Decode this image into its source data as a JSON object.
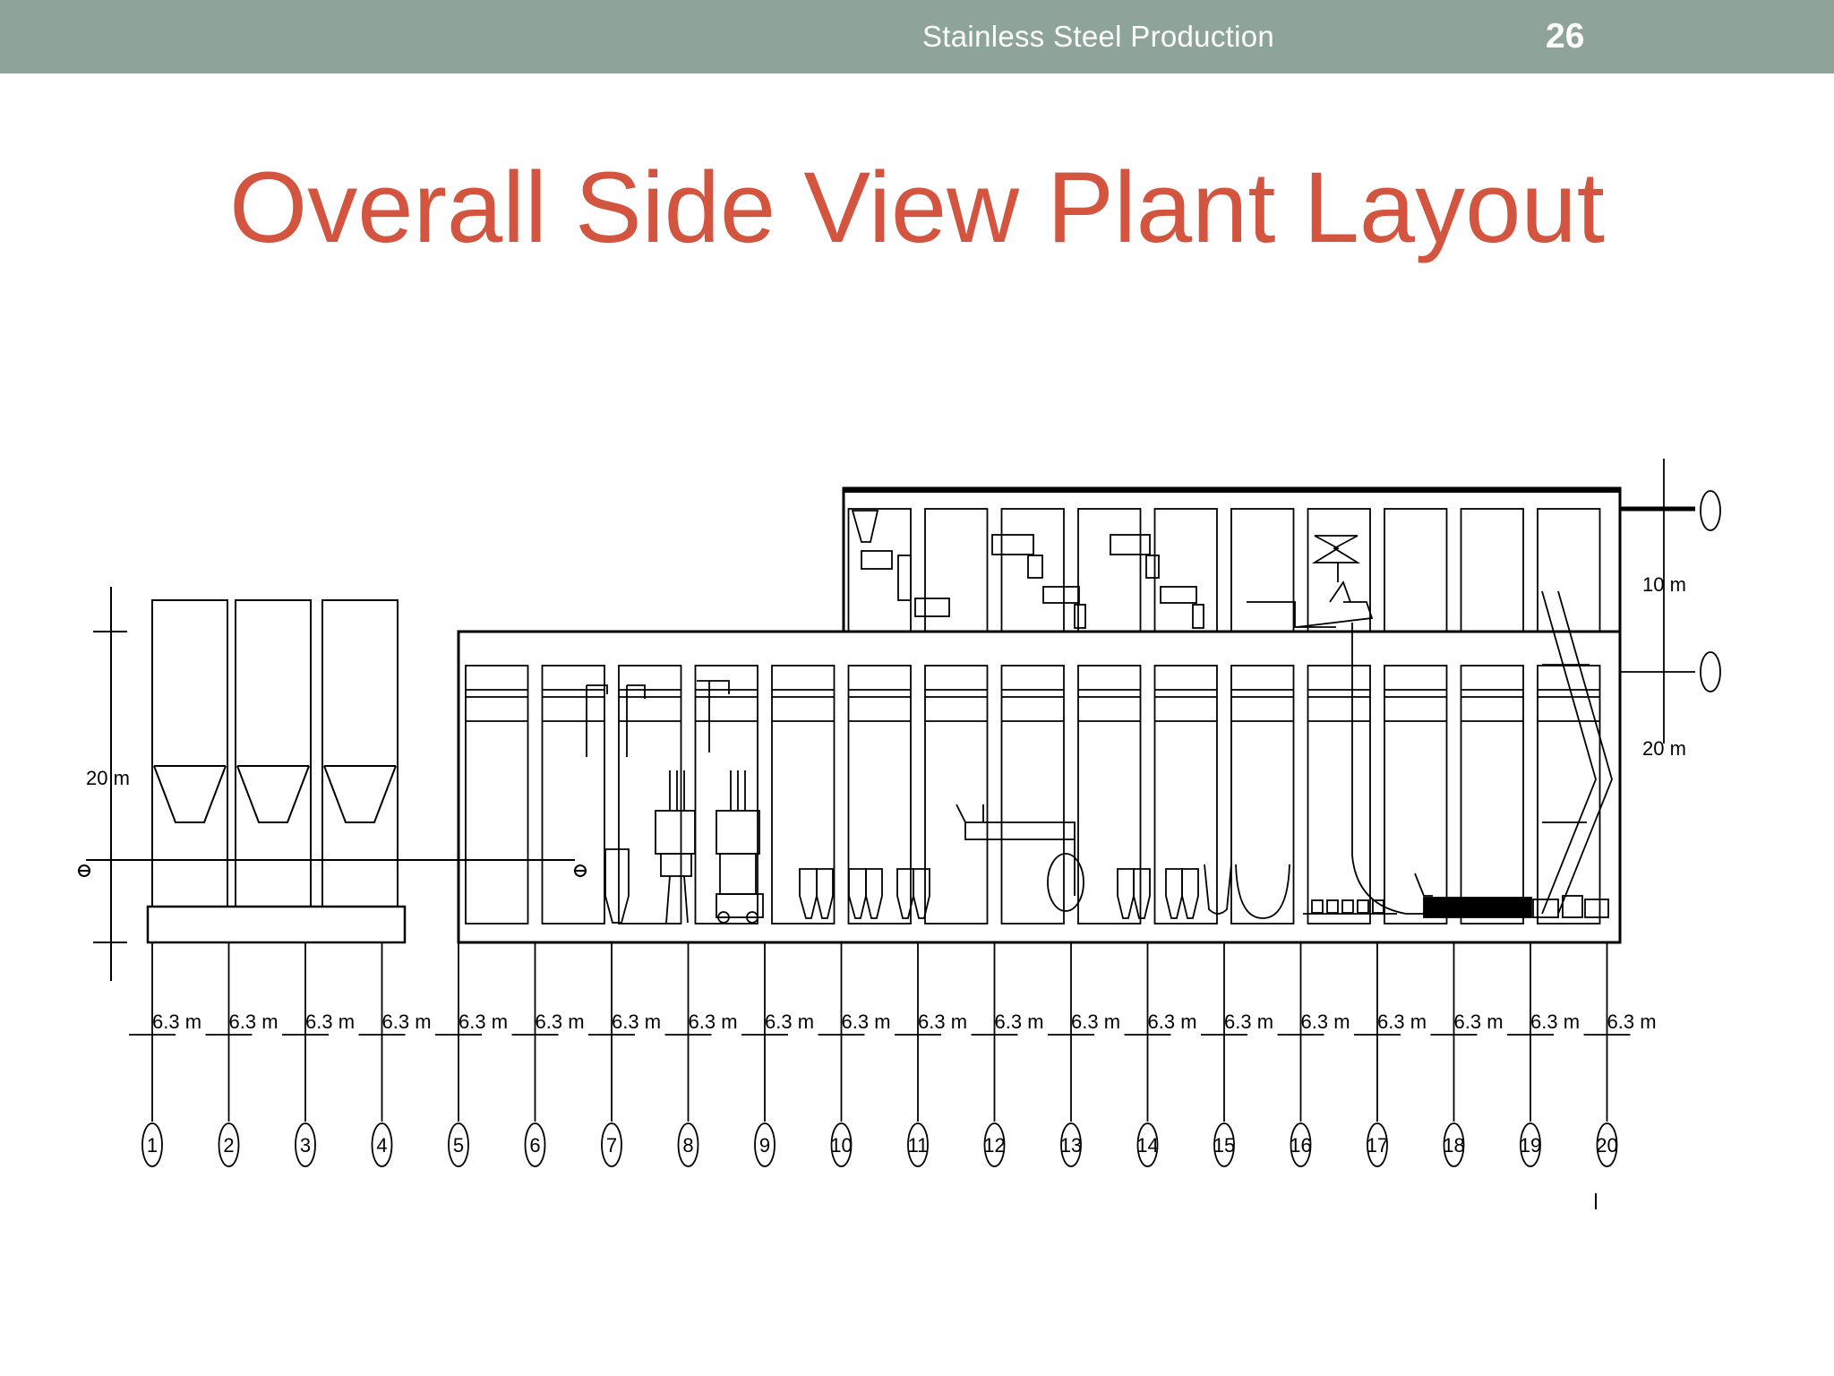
{
  "header": {
    "title": "Stainless Steel Production",
    "slide_number": "26"
  },
  "slide": {
    "title": "Overall Side View Plant Layout"
  },
  "drawing": {
    "height_labels": {
      "left": "20 m",
      "right_upper": "10 m",
      "right_lower": "20 m"
    },
    "bay_spacing_label": "6.3 m",
    "bay_count": 20,
    "axis_labels": [
      "1",
      "2",
      "3",
      "4",
      "5",
      "6",
      "7",
      "8",
      "9",
      "10",
      "11",
      "12",
      "13",
      "14",
      "15",
      "16",
      "17",
      "18",
      "19",
      "20"
    ]
  },
  "colors": {
    "header_bg": "#8ea49a",
    "title": "#d3543f",
    "line": "#000000"
  }
}
